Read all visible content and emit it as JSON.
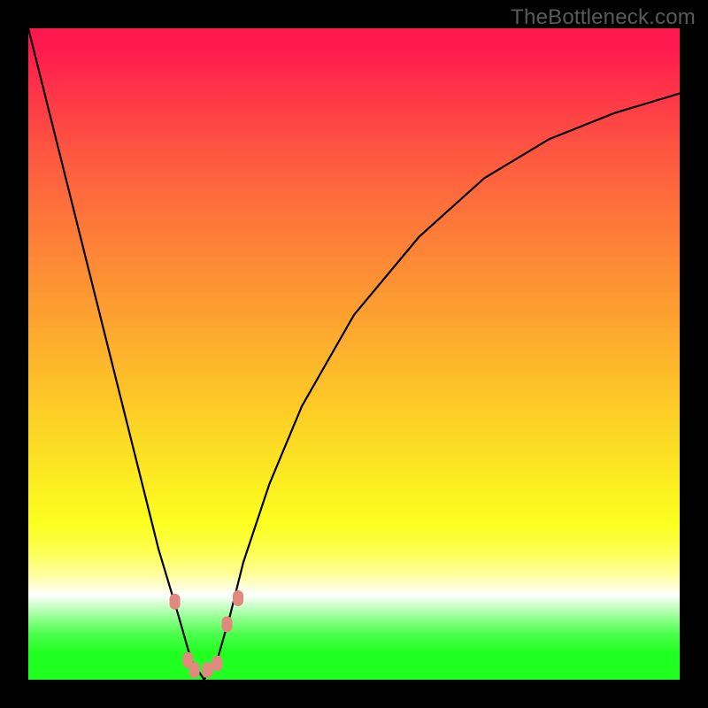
{
  "watermark": "TheBottleneck.com",
  "colors": {
    "curve_stroke": "#000000",
    "marker_fill": "#E1887F",
    "background_black": "#000000"
  },
  "chart_data": {
    "type": "line",
    "title": "",
    "xlabel": "",
    "ylabel": "",
    "x_range": [
      0,
      100
    ],
    "y_range": [
      0,
      100
    ],
    "notes": "Bottleneck V-curve. A single valley near x≈27 where bottleneck % drops to ~0. Background vertical gradient encodes bottleneck severity (red=high, green=low). Values estimated from pixel positions; chart has no visible axes or tick labels.",
    "series": [
      {
        "name": "bottleneck_percent",
        "x": [
          0,
          5,
          10,
          15,
          20,
          23,
          25,
          27,
          29,
          31,
          33,
          37,
          42,
          50,
          60,
          70,
          80,
          90,
          100
        ],
        "values": [
          100,
          80,
          60,
          40,
          20,
          10,
          3,
          0,
          3,
          10,
          18,
          30,
          42,
          56,
          68,
          77,
          83,
          87,
          90
        ]
      }
    ],
    "markers": {
      "name": "highlighted_points",
      "x": [
        22.5,
        24.5,
        25.5,
        27.5,
        29.0,
        30.5,
        32.2
      ],
      "values": [
        12.0,
        3.0,
        1.5,
        1.5,
        2.5,
        8.5,
        12.5
      ]
    }
  }
}
